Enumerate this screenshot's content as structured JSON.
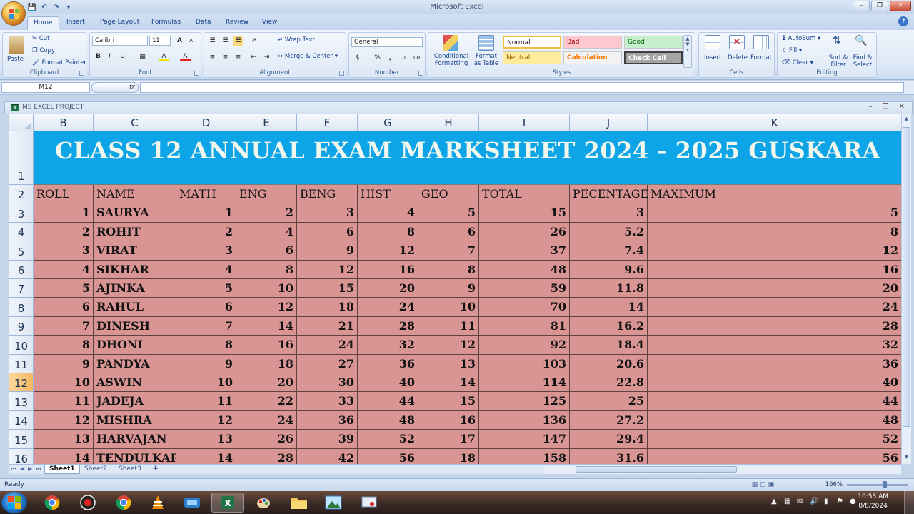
{
  "app": {
    "window_title": "Microsoft Excel",
    "help": "?"
  },
  "tabs": [
    "Home",
    "Insert",
    "Page Layout",
    "Formulas",
    "Data",
    "Review",
    "View"
  ],
  "ribbon": {
    "clipboard": {
      "label": "Clipboard",
      "paste": "Paste",
      "cut": "Cut",
      "copy": "Copy",
      "format_painter": "Format Painter"
    },
    "font": {
      "label": "Font",
      "name": "Calibri",
      "size": "11",
      "bold": "B",
      "italic": "I",
      "underline": "U",
      "grow": "A",
      "shrink": "A",
      "fill": "A",
      "color": "A"
    },
    "alignment": {
      "label": "Alignment",
      "wrap_text": "Wrap Text",
      "merge_center": "Merge & Center"
    },
    "number": {
      "label": "Number",
      "format": "General",
      "currency": "$",
      "percent": "%",
      "comma": ","
    },
    "styles": {
      "label": "Styles",
      "conditional": "Conditional Formatting",
      "format_table": "Format as Table",
      "cells": [
        {
          "name": "Normal",
          "bg": "#ffffff",
          "fg": "#222222"
        },
        {
          "name": "Bad",
          "bg": "#ffc7ce",
          "fg": "#9c0006"
        },
        {
          "name": "Good",
          "bg": "#c6efce",
          "fg": "#006100"
        },
        {
          "name": "Neutral",
          "bg": "#ffeb9c",
          "fg": "#9c6500"
        },
        {
          "name": "Calculation",
          "bg": "#f2f2f2",
          "fg": "#fa7d00"
        },
        {
          "name": "Check Cell",
          "bg": "#a5a5a5",
          "fg": "#ffffff"
        }
      ]
    },
    "cells": {
      "label": "Cells",
      "insert": "Insert",
      "delete": "Delete",
      "format": "Format"
    },
    "editing": {
      "label": "Editing",
      "autosum": "AutoSum",
      "fill": "Fill",
      "clear": "Clear",
      "sort_filter": "Sort & Filter",
      "find_select": "Find & Select"
    }
  },
  "formula_bar": {
    "name_box": "M12",
    "fx": "fx",
    "value": ""
  },
  "workbook": {
    "title": "MS EXCEL PROJECT"
  },
  "sheet": {
    "columns": [
      "B",
      "C",
      "D",
      "E",
      "F",
      "G",
      "H",
      "I",
      "J",
      "K"
    ],
    "row_numbers": [
      "1",
      "2",
      "3",
      "4",
      "5",
      "6",
      "7",
      "8",
      "9",
      "10",
      "11",
      "12",
      "13",
      "14",
      "15",
      "16"
    ],
    "selected_row": "12",
    "title": "CLASS 12 ANNUAL EXAM MARKSHEET 2024 - 2025 GUSKARA",
    "title_bg": "#0ea5e8",
    "cell_bg": "#d99594",
    "headers": [
      "ROLL",
      "NAME",
      "MATH",
      "ENG",
      "BENG",
      "HIST",
      "GEO",
      "TOTAL",
      "PECENTAGE",
      "MAXIMUM"
    ],
    "rows": [
      [
        "1",
        "SAURYA",
        "1",
        "2",
        "3",
        "4",
        "5",
        "15",
        "3",
        "5"
      ],
      [
        "2",
        "ROHIT",
        "2",
        "4",
        "6",
        "8",
        "6",
        "26",
        "5.2",
        "8"
      ],
      [
        "3",
        "VIRAT",
        "3",
        "6",
        "9",
        "12",
        "7",
        "37",
        "7.4",
        "12"
      ],
      [
        "4",
        "SIKHAR",
        "4",
        "8",
        "12",
        "16",
        "8",
        "48",
        "9.6",
        "16"
      ],
      [
        "5",
        "AJINKA",
        "5",
        "10",
        "15",
        "20",
        "9",
        "59",
        "11.8",
        "20"
      ],
      [
        "6",
        "RAHUL",
        "6",
        "12",
        "18",
        "24",
        "10",
        "70",
        "14",
        "24"
      ],
      [
        "7",
        "DINESH",
        "7",
        "14",
        "21",
        "28",
        "11",
        "81",
        "16.2",
        "28"
      ],
      [
        "8",
        "DHONI",
        "8",
        "16",
        "24",
        "32",
        "12",
        "92",
        "18.4",
        "32"
      ],
      [
        "9",
        "PANDYA",
        "9",
        "18",
        "27",
        "36",
        "13",
        "103",
        "20.6",
        "36"
      ],
      [
        "10",
        "ASWIN",
        "10",
        "20",
        "30",
        "40",
        "14",
        "114",
        "22.8",
        "40"
      ],
      [
        "11",
        "JADEJA",
        "11",
        "22",
        "33",
        "44",
        "15",
        "125",
        "25",
        "44"
      ],
      [
        "12",
        "MISHRA",
        "12",
        "24",
        "36",
        "48",
        "16",
        "136",
        "27.2",
        "48"
      ],
      [
        "13",
        "HARVAJAN",
        "13",
        "26",
        "39",
        "52",
        "17",
        "147",
        "29.4",
        "52"
      ],
      [
        "14",
        "TENDULKAR",
        "14",
        "28",
        "42",
        "56",
        "18",
        "158",
        "31.6",
        "56"
      ]
    ]
  },
  "sheet_tabs": [
    "Sheet1",
    "Sheet2",
    "Sheet3"
  ],
  "status": {
    "ready": "Ready",
    "zoom": "166%"
  },
  "taskbar": {
    "time": "10:53 AM",
    "date": "8/8/2024"
  }
}
